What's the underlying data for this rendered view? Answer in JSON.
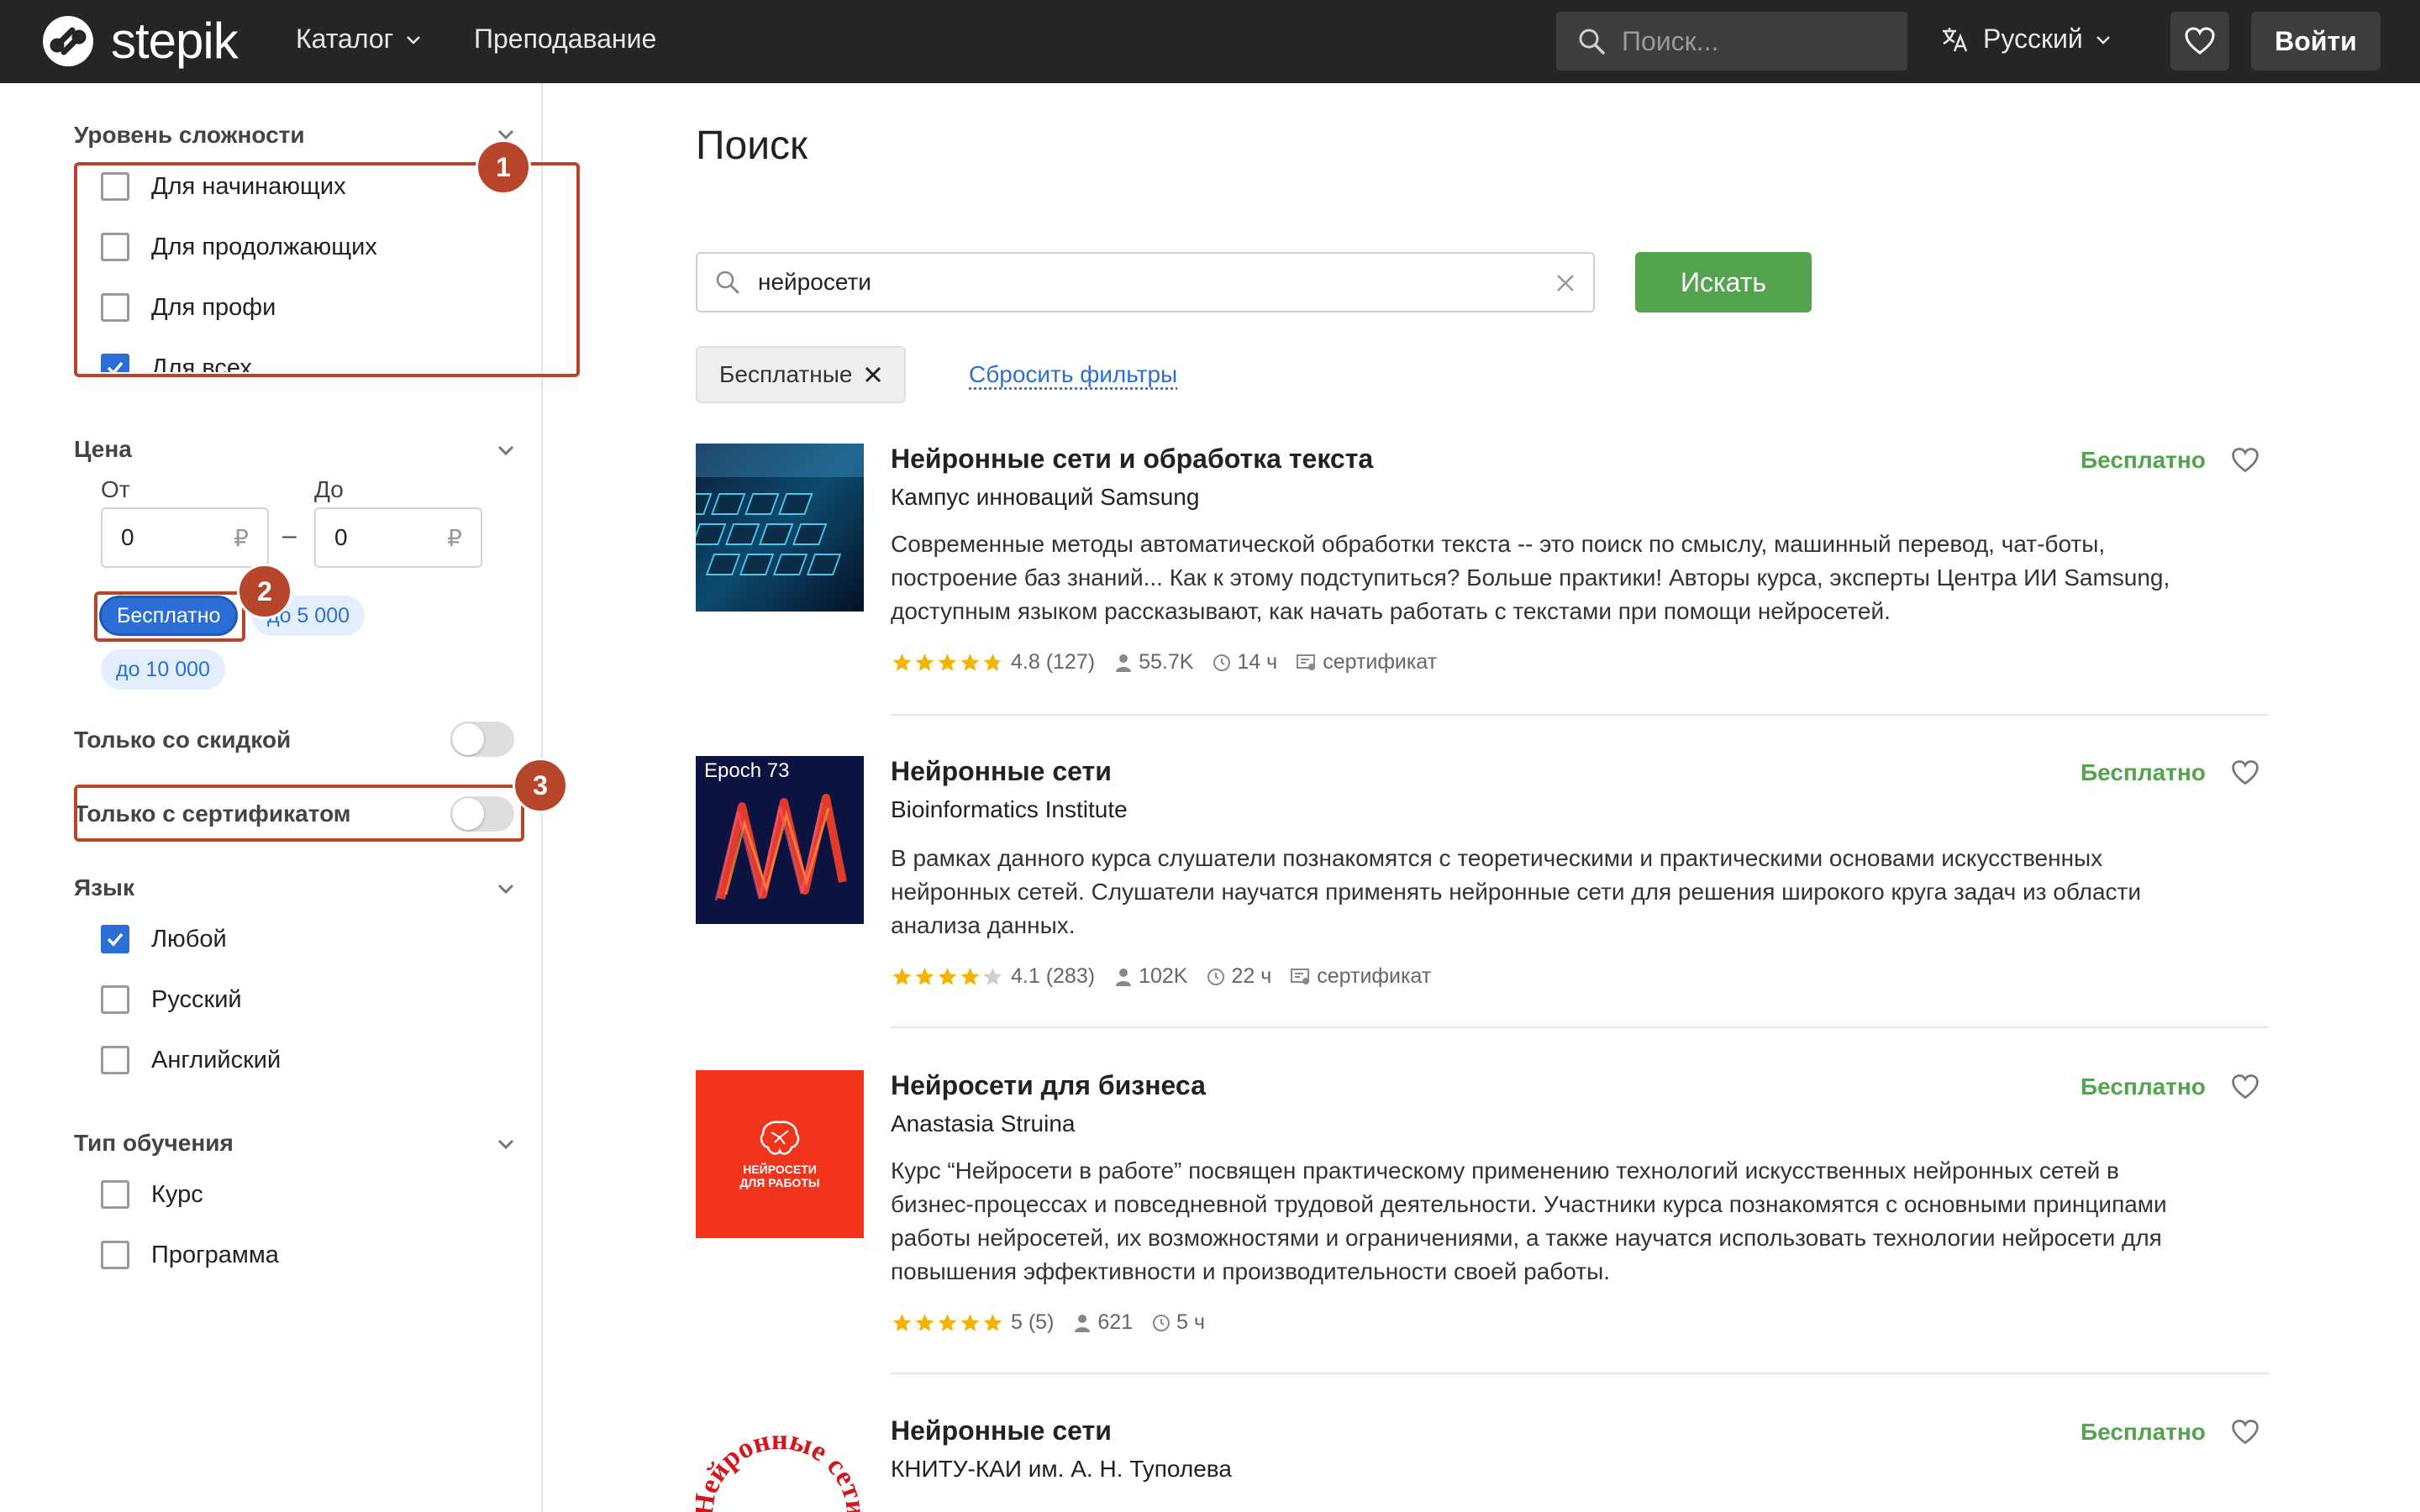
{
  "header": {
    "logo_text": "stepik",
    "nav": {
      "catalog": "Каталог",
      "teaching": "Преподавание"
    },
    "search_placeholder": "Поиск...",
    "language": "Русский",
    "login": "Войти"
  },
  "sidebar": {
    "difficulty": {
      "title": "Уровень сложности",
      "options": [
        {
          "label": "Для начинающих",
          "checked": false
        },
        {
          "label": "Для продолжающих",
          "checked": false
        },
        {
          "label": "Для профи",
          "checked": false
        },
        {
          "label": "Для всех",
          "checked": true
        }
      ]
    },
    "price": {
      "title": "Цена",
      "from_label": "От",
      "to_label": "До",
      "from_value": "0",
      "to_value": "0",
      "currency": "₽",
      "dash": "–",
      "chips": [
        "Бесплатно",
        "до 5 000",
        "до 10 000"
      ],
      "active_chip": "Бесплатно"
    },
    "discount_only": {
      "label": "Только со скидкой",
      "on": false
    },
    "certificate_only": {
      "label": "Только с сертификатом",
      "on": false
    },
    "language": {
      "title": "Язык",
      "options": [
        {
          "label": "Любой",
          "checked": true
        },
        {
          "label": "Русский",
          "checked": false
        },
        {
          "label": "Английский",
          "checked": false
        }
      ]
    },
    "learning_type": {
      "title": "Тип обучения",
      "options": [
        {
          "label": "Курс",
          "checked": false
        },
        {
          "label": "Программа",
          "checked": false
        }
      ]
    },
    "annotations": [
      "1",
      "2",
      "3"
    ]
  },
  "main": {
    "title": "Поиск",
    "search_value": "нейросети",
    "search_button": "Искать",
    "active_filter": "Бесплатные",
    "reset_filters": "Сбросить фильтры",
    "courses": [
      {
        "title": "Нейронные сети и обработка текста",
        "author": "Кампус инноваций Samsung",
        "description": "Современные методы автоматической обработки текста -- это поиск по смыслу, машинный перевод, чат-боты, построение баз знаний... Как к этому подступиться? Больше практики! Авторы курса, эксперты Центра ИИ Samsung, доступным языком рассказывают, как начать работать с текстами при помощи нейросетей.",
        "rating": "4.8 (127)",
        "rating_value": 4.8,
        "learners": "55.7K",
        "duration": "14 ч",
        "certificate": "сертификат",
        "price": "Бесплатно"
      },
      {
        "title": "Нейронные сети",
        "author": "Bioinformatics Institute",
        "description": "В рамках данного курса слушатели познакомятся с теоретическими и практическими основами искусственных нейронных сетей. Слушатели научатся применять нейронные сети для решения широкого круга задач из области анализа данных.",
        "rating": "4.1 (283)",
        "rating_value": 4.1,
        "learners": "102K",
        "duration": "22 ч",
        "certificate": "сертификат",
        "price": "Бесплатно",
        "thumb_text": "Epoch 73"
      },
      {
        "title": "Нейросети для бизнеса",
        "author": "Anastasia Struina",
        "description": "Курс “Нейросети в работе” посвящен практическому применению технологий искусственных нейронных сетей в бизнес-процессах и повседневной трудовой деятельности. Участники курса познакомятся с основными принципами работы нейросетей, их возможностями и ограничениями, а также научатся использовать технологии нейросети для повышения эффективности и производительности своей работы.",
        "rating": "5 (5)",
        "rating_value": 5,
        "learners": "621",
        "duration": "5 ч",
        "price": "Бесплатно",
        "thumb_text": "НЕЙРОСЕТИ ДЛЯ РАБОТЫ"
      },
      {
        "title": "Нейронные сети",
        "author": "КНИТУ-КАИ им. А. Н. Туполева",
        "price": "Бесплатно",
        "thumb_text": "Нейронные сети"
      }
    ]
  },
  "colors": {
    "header_bg": "#252525",
    "accent_blue": "#2b6fd6",
    "green": "#54a34e",
    "annotation": "#b6452c"
  }
}
